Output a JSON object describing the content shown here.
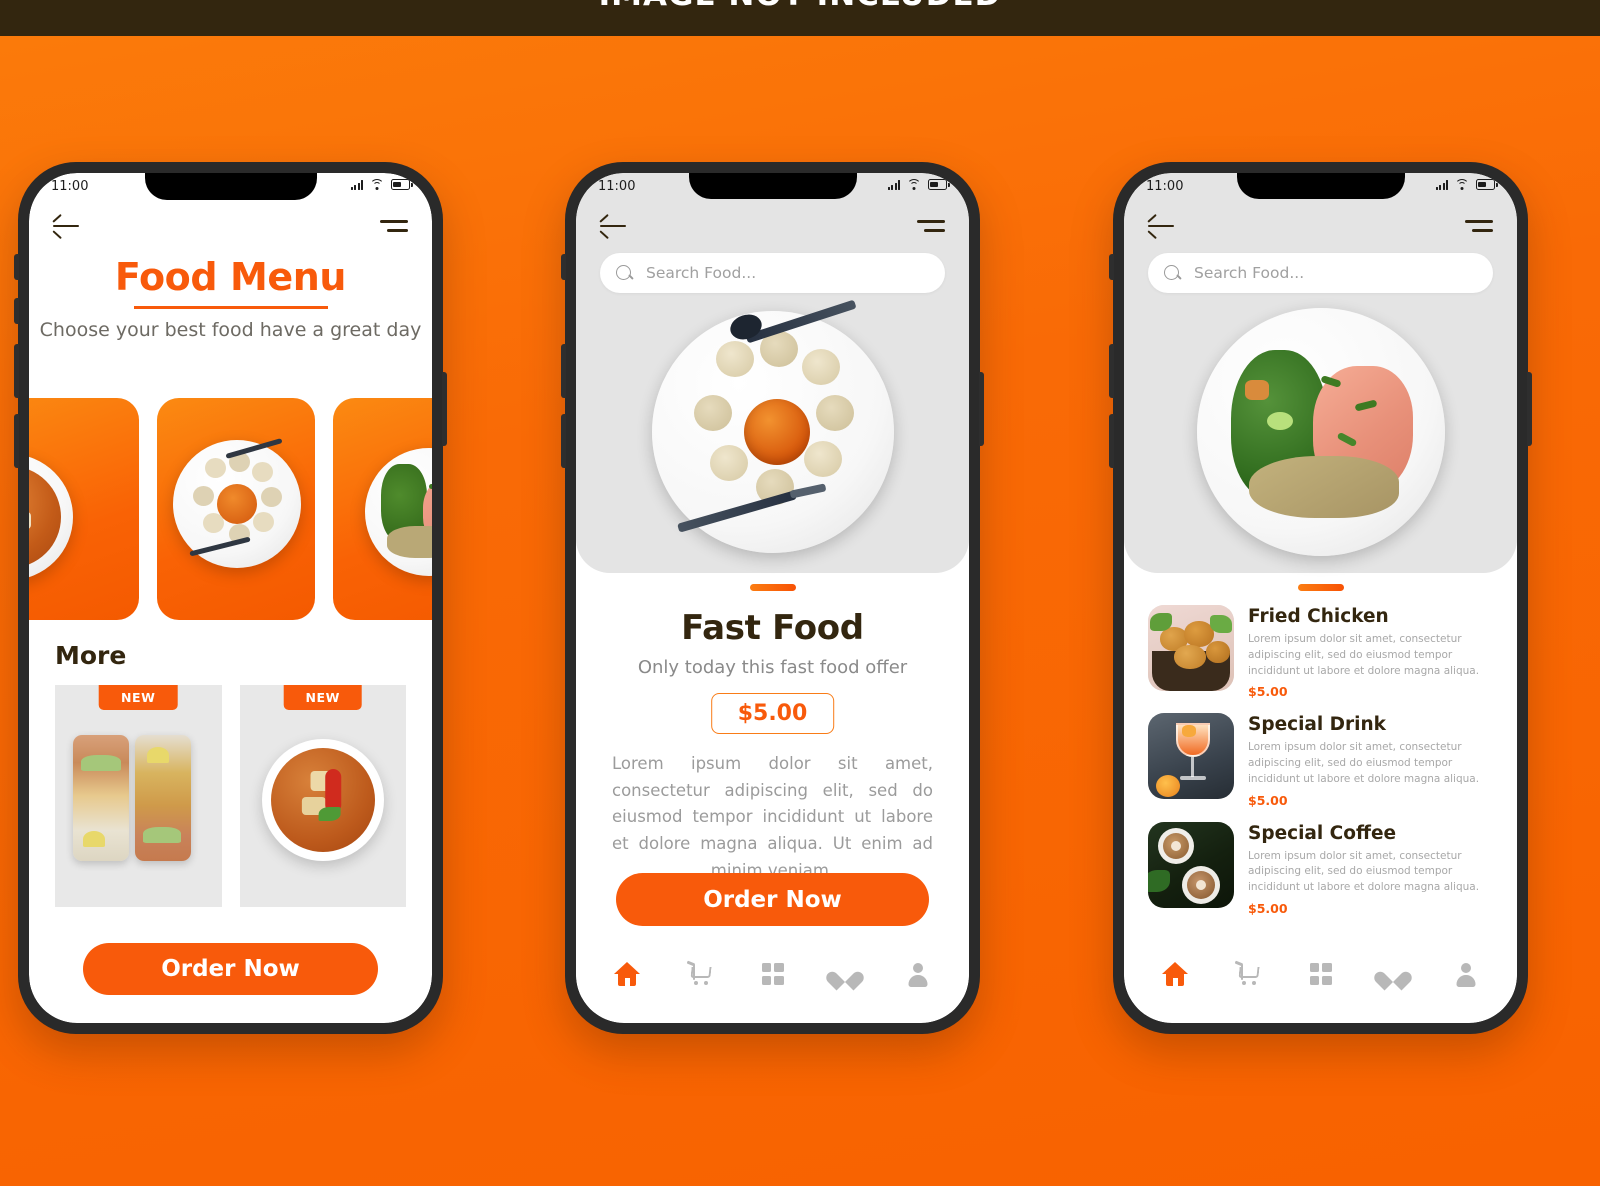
{
  "banner": {
    "text": "IMAGE NOT INCLUDED"
  },
  "theme": {
    "accent": "#f85a0b",
    "background": "#f96a06",
    "dark_text": "#33260f",
    "muted_text": "#9b9b9b",
    "screen_gray": "#e4e4e4"
  },
  "status_bar": {
    "time": "11:00"
  },
  "screen1": {
    "title": "Food Menu",
    "subtitle": "Choose your best food have a great day",
    "section_heading": "More",
    "carousel": [
      {
        "alt": "mapo-tofu-plate"
      },
      {
        "alt": "momo-dumplings-plate"
      },
      {
        "alt": "salmon-broccoli-plate"
      }
    ],
    "more_cards": [
      {
        "badge": "NEW",
        "alt": "bento-chickpea-rice-boxes"
      },
      {
        "badge": "NEW",
        "alt": "tofu-curry-bowl"
      }
    ],
    "order_button": "Order Now"
  },
  "screen2": {
    "search_placeholder": "Search Food...",
    "hero_alt": "momo-dumplings-plate",
    "title": "Fast Food",
    "subtitle": "Only today this fast food offer",
    "price": "$5.00",
    "description": "Lorem ipsum dolor sit amet, consectetur adipiscing elit, sed do eiusmod tempor incididunt ut labore et dolore magna aliqua. Ut enim ad minim veniam.",
    "order_button": "Order Now",
    "nav": [
      {
        "icon": "home-icon",
        "active": true
      },
      {
        "icon": "cart-icon",
        "active": false
      },
      {
        "icon": "grid-icon",
        "active": false
      },
      {
        "icon": "heart-icon",
        "active": false
      },
      {
        "icon": "person-icon",
        "active": false
      }
    ]
  },
  "screen3": {
    "search_placeholder": "Search Food...",
    "hero_alt": "salmon-broccoli-grain-plate",
    "items": [
      {
        "name": "Fried Chicken",
        "description": "Lorem ipsum dolor sit amet, consectetur adipiscing elit, sed do eiusmod tempor incididunt ut labore et dolore magna aliqua.",
        "price": "$5.00",
        "alt": "fried-chicken-basket"
      },
      {
        "name": "Special Drink",
        "description": "Lorem ipsum dolor sit amet, consectetur adipiscing elit, sed do eiusmod tempor incididunt ut labore et dolore magna aliqua.",
        "price": "$5.00",
        "alt": "orange-cocktail-glass"
      },
      {
        "name": "Special Coffee",
        "description": "Lorem ipsum dolor sit amet, consectetur adipiscing elit, sed do eiusmod tempor incididunt ut labore et dolore magna aliqua.",
        "price": "$5.00",
        "alt": "latte-art-cups"
      }
    ],
    "nav": [
      {
        "icon": "home-icon",
        "active": true
      },
      {
        "icon": "cart-icon",
        "active": false
      },
      {
        "icon": "grid-icon",
        "active": false
      },
      {
        "icon": "heart-icon",
        "active": false
      },
      {
        "icon": "person-icon",
        "active": false
      }
    ]
  }
}
